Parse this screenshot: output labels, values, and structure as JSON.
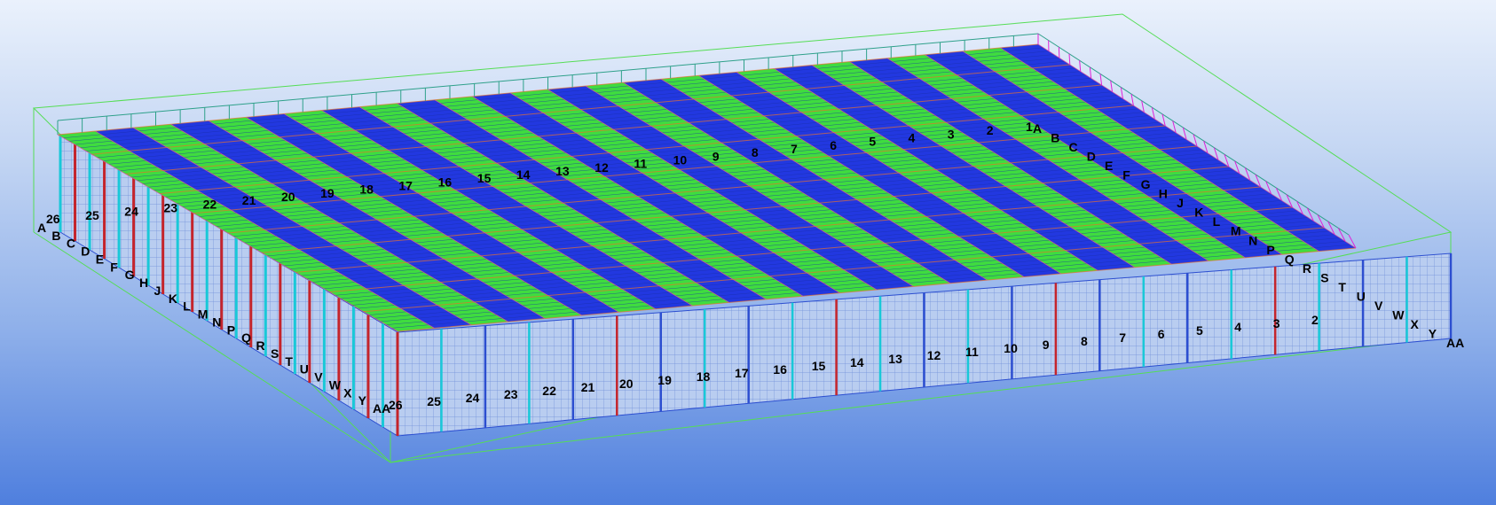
{
  "view": {
    "type": "3d-steel-structure-model",
    "background_colors": [
      "#eaf1fc",
      "#4f7fde"
    ],
    "member_colors": {
      "roof_purlin_green": "#3fdc3f",
      "roof_purlin_blue": "#2238e0",
      "column_red": "#c4242c",
      "wall_cyan": "#19c8d8",
      "brace_magenta": "#e020d8",
      "bracket_orange": "#e8702a",
      "bounding_box": "#55dd55"
    }
  },
  "grid_labels": {
    "front_numbers": [
      "26",
      "25",
      "24",
      "23",
      "22",
      "21",
      "20",
      "19",
      "18",
      "17",
      "16",
      "15",
      "14",
      "13",
      "12",
      "11",
      "10",
      "9",
      "8",
      "7",
      "6",
      "5",
      "4",
      "3",
      "2"
    ],
    "back_numbers": [
      "26",
      "25",
      "24",
      "23",
      "22",
      "21",
      "20",
      "19",
      "18",
      "17",
      "16",
      "15",
      "14",
      "13",
      "12",
      "11",
      "10",
      "9",
      "8",
      "7",
      "6",
      "5",
      "4",
      "3",
      "2",
      "1"
    ],
    "left_letters": [
      "A",
      "B",
      "C",
      "D",
      "E",
      "F",
      "G",
      "H",
      "J",
      "K",
      "L",
      "M",
      "N",
      "P",
      "Q",
      "R",
      "S",
      "T",
      "U",
      "V",
      "W",
      "X",
      "Y",
      "AA"
    ],
    "right_letters": [
      "A",
      "B",
      "C",
      "D",
      "E",
      "F",
      "G",
      "H",
      "J",
      "K",
      "L",
      "M",
      "N",
      "P",
      "Q",
      "R",
      "S",
      "T",
      "U",
      "V",
      "W",
      "X",
      "Y",
      "AA"
    ]
  }
}
